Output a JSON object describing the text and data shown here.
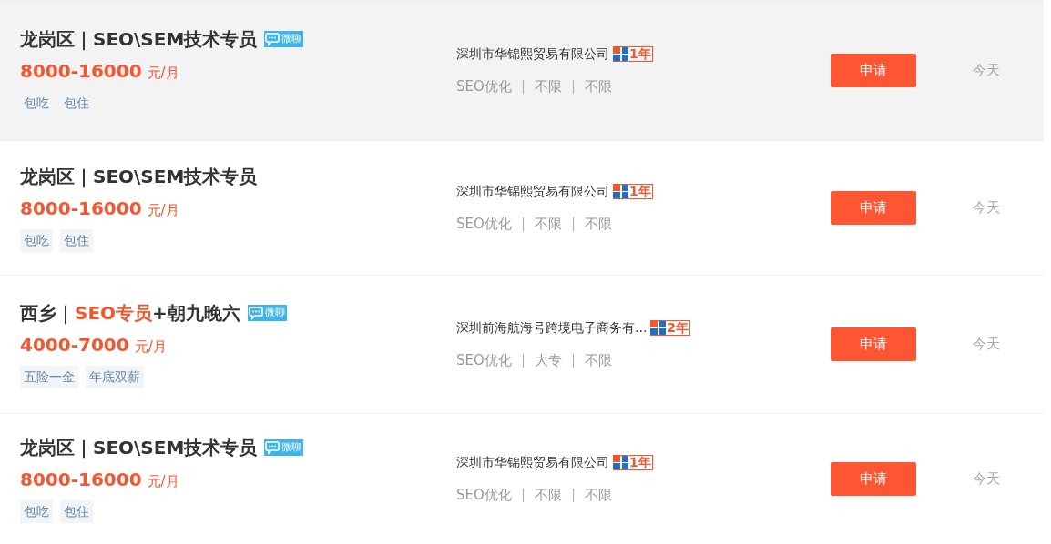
{
  "jobs": [
    {
      "highlighted": true,
      "title_parts": [
        {
          "text": "龙岗区｜SEO\\SEM技术专员",
          "highlight": false
        }
      ],
      "chat_badge": "微聊",
      "salary": "8000-16000",
      "salary_unit": "元/月",
      "tags": [
        "包吃",
        "包住"
      ],
      "company": "深圳市华锦熙贸易有限公司",
      "company_years": "1年",
      "requirements": [
        "SEO优化",
        "不限",
        "不限"
      ],
      "apply_button": "申请",
      "posted": "今天"
    },
    {
      "highlighted": false,
      "title_parts": [
        {
          "text": "龙岗区｜SEO\\SEM技术专员",
          "highlight": false
        }
      ],
      "salary": "8000-16000",
      "salary_unit": "元/月",
      "tags": [
        "包吃",
        "包住"
      ],
      "company": "深圳市华锦熙贸易有限公司",
      "company_years": "1年",
      "requirements": [
        "SEO优化",
        "不限",
        "不限"
      ],
      "apply_button": "申请",
      "posted": "今天"
    },
    {
      "highlighted": false,
      "title_parts": [
        {
          "text": "西乡｜",
          "highlight": false
        },
        {
          "text": "SEO专员",
          "highlight": true
        },
        {
          "text": "+朝九晚六",
          "highlight": false
        }
      ],
      "chat_badge": "微聊",
      "salary": "4000-7000",
      "salary_unit": "元/月",
      "tags": [
        "五险一金",
        "年底双薪"
      ],
      "company": "深圳前海航海号跨境电子商务有...",
      "company_years": "2年",
      "requirements": [
        "SEO优化",
        "大专",
        "不限"
      ],
      "apply_button": "申请",
      "posted": "今天"
    },
    {
      "highlighted": false,
      "title_parts": [
        {
          "text": "龙岗区｜SEO\\SEM技术专员",
          "highlight": false
        }
      ],
      "chat_badge": "微聊",
      "salary": "8000-16000",
      "salary_unit": "元/月",
      "tags": [
        "包吃",
        "包住"
      ],
      "company": "深圳市华锦熙贸易有限公司",
      "company_years": "1年",
      "requirements": [
        "SEO优化",
        "不限",
        "不限"
      ],
      "apply_button": "申请",
      "posted": "今天"
    }
  ]
}
